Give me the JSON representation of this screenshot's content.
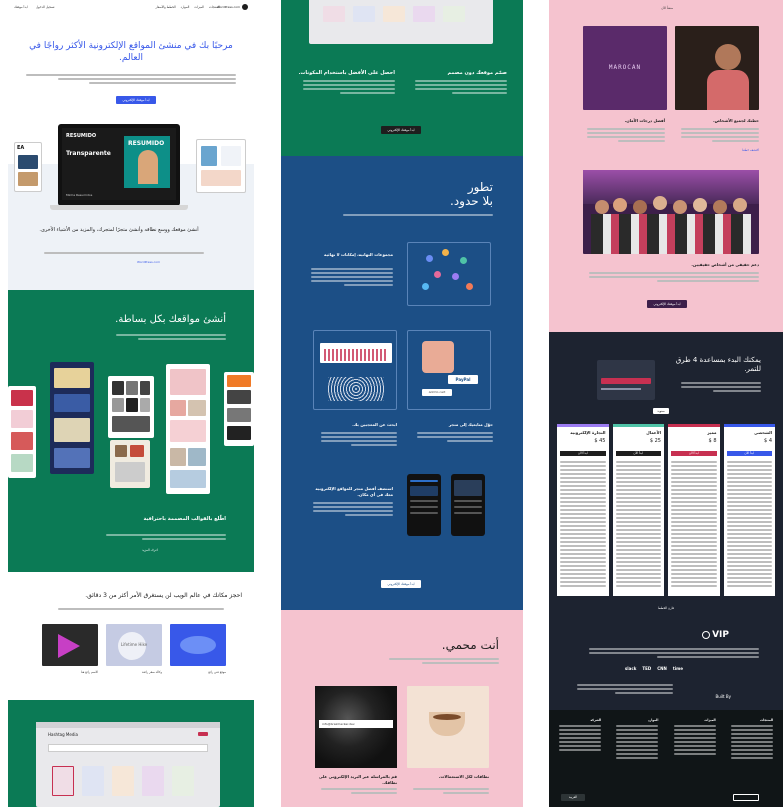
{
  "col1": {
    "header": {
      "logo_text": "WordPress.com",
      "nav_items": [
        "المنتجات",
        "الميزات",
        "الموارد",
        "الخطط والأسعار"
      ],
      "login": "تسجيل الدخول",
      "start": "ابدأ موقعك"
    },
    "hero": {
      "title": "مرحبًا بك في منشئ المواقع الإلكترونية الأكثر رواجًا في العالم.",
      "button": "ابدأ موقعك الإلكتروني",
      "mockup_brand": "RESUMIDO",
      "mockup_heading": "Transparente",
      "mockup_footer": "Minha Resumidos"
    },
    "promo": {
      "title": "أنشئ موقعك ووسع نطاقه وأنشئ متجرًا لمتجرك، والمزيد من الأشياء الأخرى.",
      "link": "WordPress.com"
    },
    "green": {
      "title": "أنشئ مواقعك بكل بساطة.",
      "feature_title": "اطّلع بالقوالب المصممة باحترافية",
      "feature_link": "اعرف المزيد"
    },
    "domains": {
      "title": "احجز مكانك في عالم الويب لن يستغرق الأمر أكثر من 3 دقائق.",
      "cards": [
        "الاسم رائع هنا",
        "وكالة سفر رائعة",
        "موقع فني رائع"
      ],
      "card_center_text": "Lifetime Hike"
    },
    "editor": {
      "title": "Hashtag Media"
    }
  },
  "col2": {
    "green_top": {
      "feature1_title": "صمّم موقعك دون مصمم",
      "feature2_title": "احصل على الأفضل باستخدام المكونات.",
      "button": "ابدأ موقعك الإلكتروني"
    },
    "blue": {
      "title_line1": "تطور",
      "title_line2": "بلا حدود.",
      "integrations_title": "مجموعات التهانية، إمكانات لا نهائية",
      "payments_title": "حوّل متابعيك إلى متجر",
      "payments_label": "PayPal",
      "payments_sub": "Add to cart",
      "audience_title": "ابحث عن المعجبين بك.",
      "hosting_title": "استضف أفضل متجر للمواقع الإلكترونية معك في أي مكان.",
      "button": "ابدأ موقعك الإلكتروني"
    },
    "pink": {
      "title": "أنت محمي.",
      "card1_title": "قم بالمراسلة عبر البريد الإلكتروني على نطاقك.",
      "card1_email": "info@brainhacker.dev",
      "card2_title": "نطاقات لكل الاستعمالات."
    }
  },
  "col3": {
    "pink": {
      "top_label": "منشأ الآن",
      "card1_title": "أفضل درجات الأمان.",
      "card2_title": "خطتك لجميع الأشخاص.",
      "card2_link": "اكتشف خطتنا",
      "group_title": "دعم حقيقي من أشخاص حقيقيين.",
      "button": "ابدأ موقعك الإلكتروني",
      "logo_text": "MAROCAN"
    },
    "pricing": {
      "title": "يمكنك البدء بمساعدة 4 طرق للتمر.",
      "toggle": "سنوية",
      "plans": [
        {
          "name": "الشخصي",
          "price": "4 $"
        },
        {
          "name": "مميز",
          "price": "8 $"
        },
        {
          "name": "الأعمال",
          "price": "25 $"
        },
        {
          "name": "التجارة الإلكترونية",
          "price": "45 $"
        }
      ],
      "plan_button": "ابدأ الآن",
      "more": "قارن الخطط"
    },
    "vip": {
      "logo": "VIP",
      "partners": [
        "slack",
        "TED",
        "CNN",
        "time"
      ],
      "built_by": "Built By"
    },
    "footer": {
      "columns": [
        "المنتجات",
        "الميزات",
        "الموارد",
        "الشركة"
      ],
      "language": "العربية"
    }
  },
  "colors": {
    "green": "#0b7a55",
    "blue": "#1c4f86",
    "pink": "#f5c3cf",
    "dark": "#1d2330",
    "accent": "#3858e9"
  }
}
